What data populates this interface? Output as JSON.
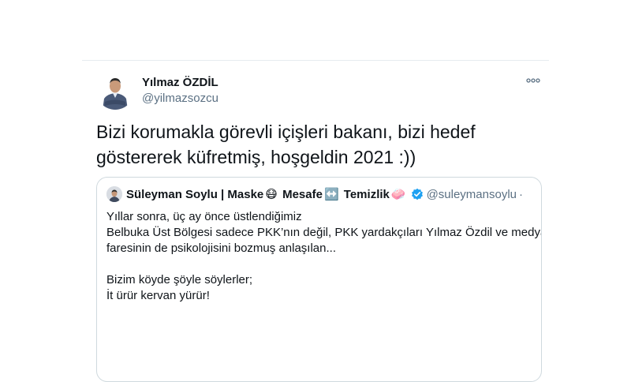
{
  "tweet": {
    "author_name": "Yılmaz ÖZDİL",
    "author_handle": "@yilmazsozcu",
    "more_icon": "more-horizontal-icon",
    "text_lines": [
      "Bizi korumakla görevli içişleri bakanı, bizi hedef",
      "göstererek küfretmiş, hoşgeldin 2021 :))"
    ]
  },
  "quote": {
    "name_part1": "Süleyman Soylu | Maske",
    "emoji_mask": "😷",
    "name_part2": " Mesafe",
    "emoji_arrows": "↔️",
    "name_part3": " Temizlik",
    "emoji_soap": "🧼",
    "verified_icon": "verified-badge-icon",
    "handle": "@suleymansoylu",
    "dot": "·",
    "lines": [
      "Yıllar sonra, üç ay önce üstlendiğimiz",
      "Belbuka Üst Bölgesi sadece PKK’nın değil, PKK yardakçıları Yılmaz Özdil ve medya",
      "faresinin de psikolojisini bozmuş anlaşılan...",
      "",
      "Bizim köyde şöyle söylerler;",
      "İt ürür kervan yürür!"
    ]
  },
  "colors": {
    "text": "#0f1419",
    "secondary": "#5b7083",
    "border": "#cfd9de",
    "verified": "#1da1f2"
  }
}
